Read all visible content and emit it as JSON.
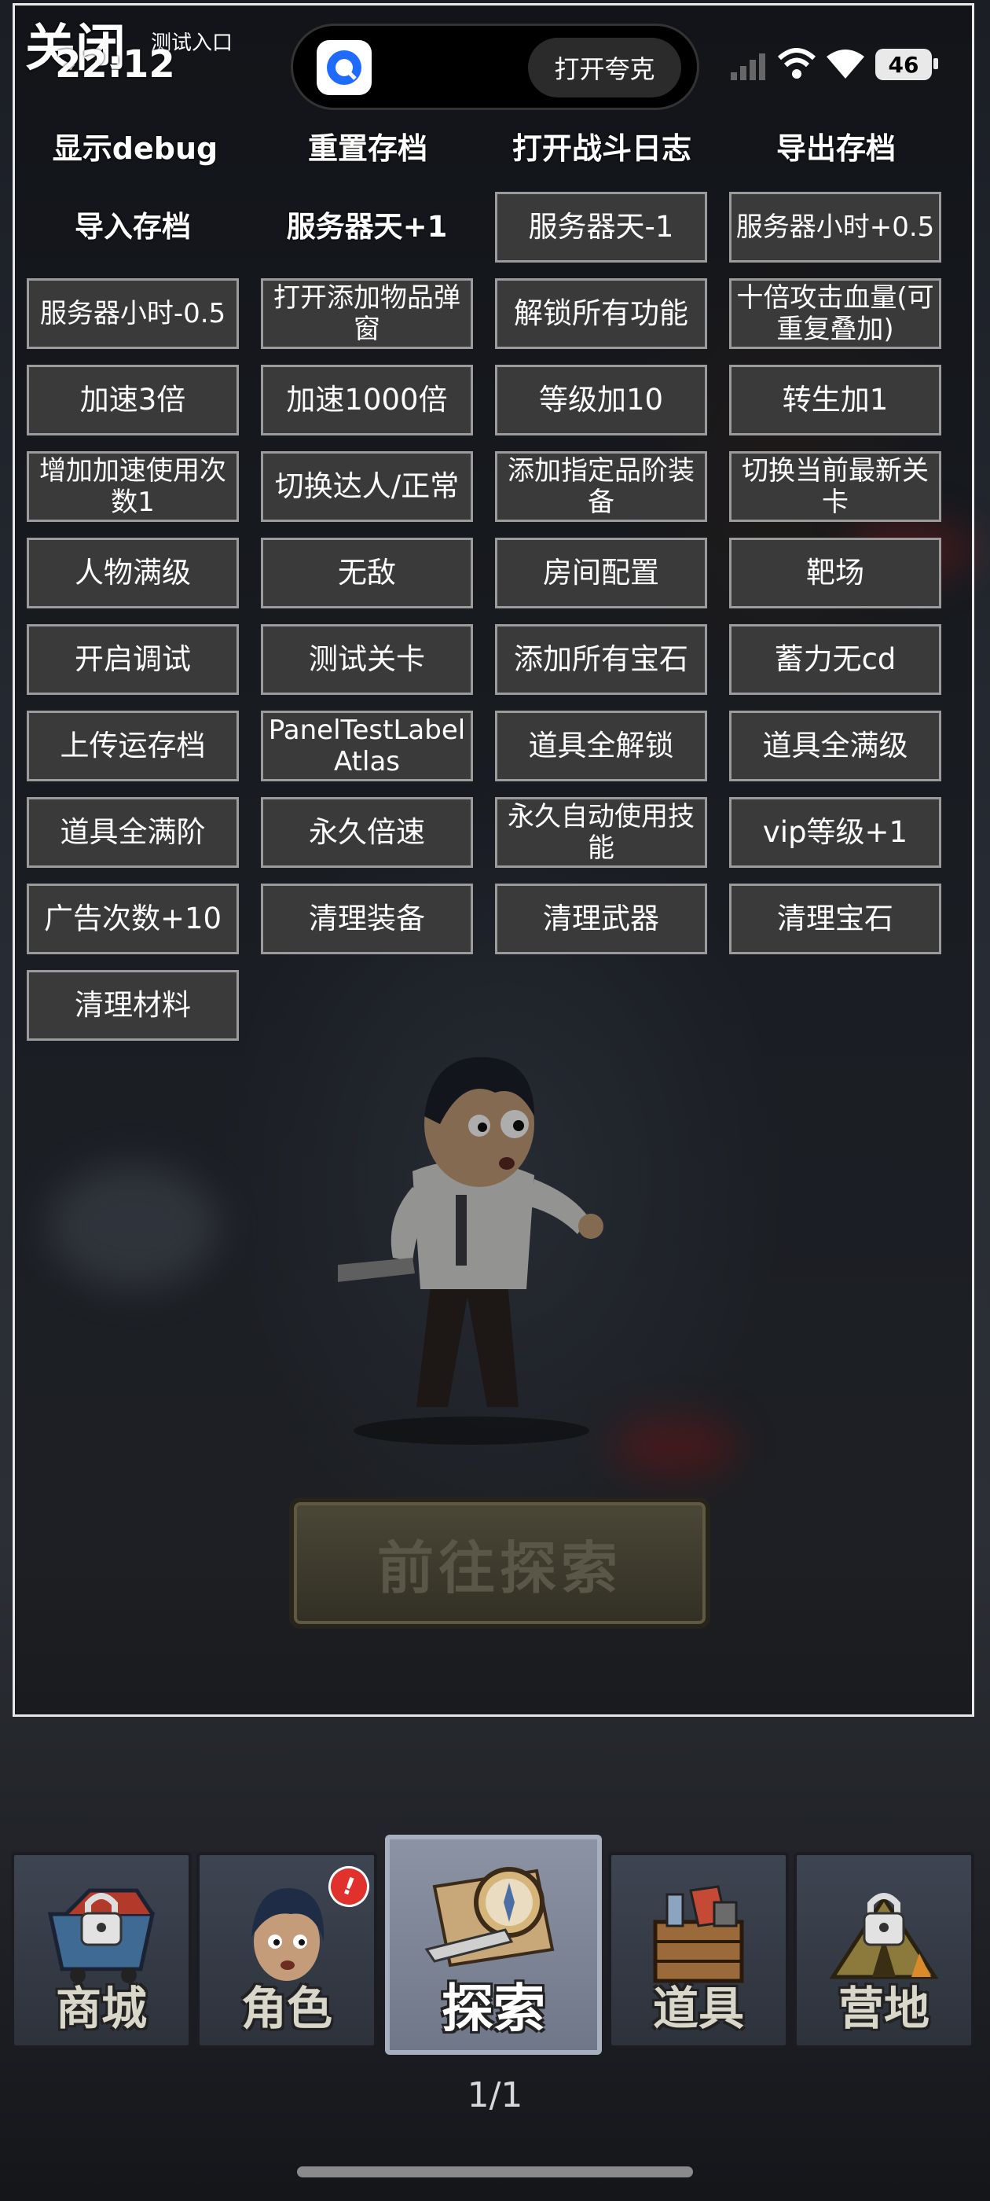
{
  "status_bar": {
    "time": "22:12",
    "battery": "46",
    "island_button": "打开夸克"
  },
  "debug_panel": {
    "close_label": "关闭",
    "test_entry_label": "测试入口",
    "top_row": [
      "显示debug",
      "重置存档",
      "打开战斗日志",
      "导出存档"
    ],
    "grid_rows": [
      [
        "导入存档",
        "服务器天+1",
        "服务器天-1",
        "服务器小时+0.5"
      ],
      [
        "服务器小时-0.5",
        "打开添加物品弹窗",
        "解锁所有功能",
        "十倍攻击血量(可重复叠加)"
      ],
      [
        "加速3倍",
        "加速1000倍",
        "等级加10",
        "转生加1"
      ],
      [
        "增加加速使用次数1",
        "切换达人/正常",
        "添加指定品阶装备",
        "切换当前最新关卡"
      ],
      [
        "人物满级",
        "无敌",
        "房间配置",
        "靶场"
      ],
      [
        "开启调试",
        "测试关卡",
        "添加所有宝石",
        "蓄力无cd"
      ],
      [
        "上传运存档",
        "PanelTestLabelAtlas",
        "道具全解锁",
        "道具全满级"
      ],
      [
        "道具全满阶",
        "永久倍速",
        "永久自动使用技能",
        "vip等级+1"
      ],
      [
        "广告次数+10",
        "清理装备",
        "清理武器",
        "清理宝石"
      ],
      [
        "清理材料"
      ]
    ]
  },
  "scene": {
    "explore_button": "前往探索"
  },
  "nav": {
    "tabs": [
      {
        "label": "商城",
        "icon": "shop-cart-icon",
        "locked": true
      },
      {
        "label": "角色",
        "icon": "character-portrait-icon",
        "badge": "!"
      },
      {
        "label": "探索",
        "icon": "compass-map-icon",
        "active": true
      },
      {
        "label": "道具",
        "icon": "supply-crate-icon"
      },
      {
        "label": "营地",
        "icon": "camp-tent-icon",
        "locked": true
      }
    ]
  },
  "page_indicator": "1/1",
  "colors": {
    "button_bg": "#3a3a3a",
    "button_border": "#9b9b9b",
    "panel_border": "#e8e8e8",
    "badge": "#e0312d",
    "active_tab": "#8b93a4"
  }
}
